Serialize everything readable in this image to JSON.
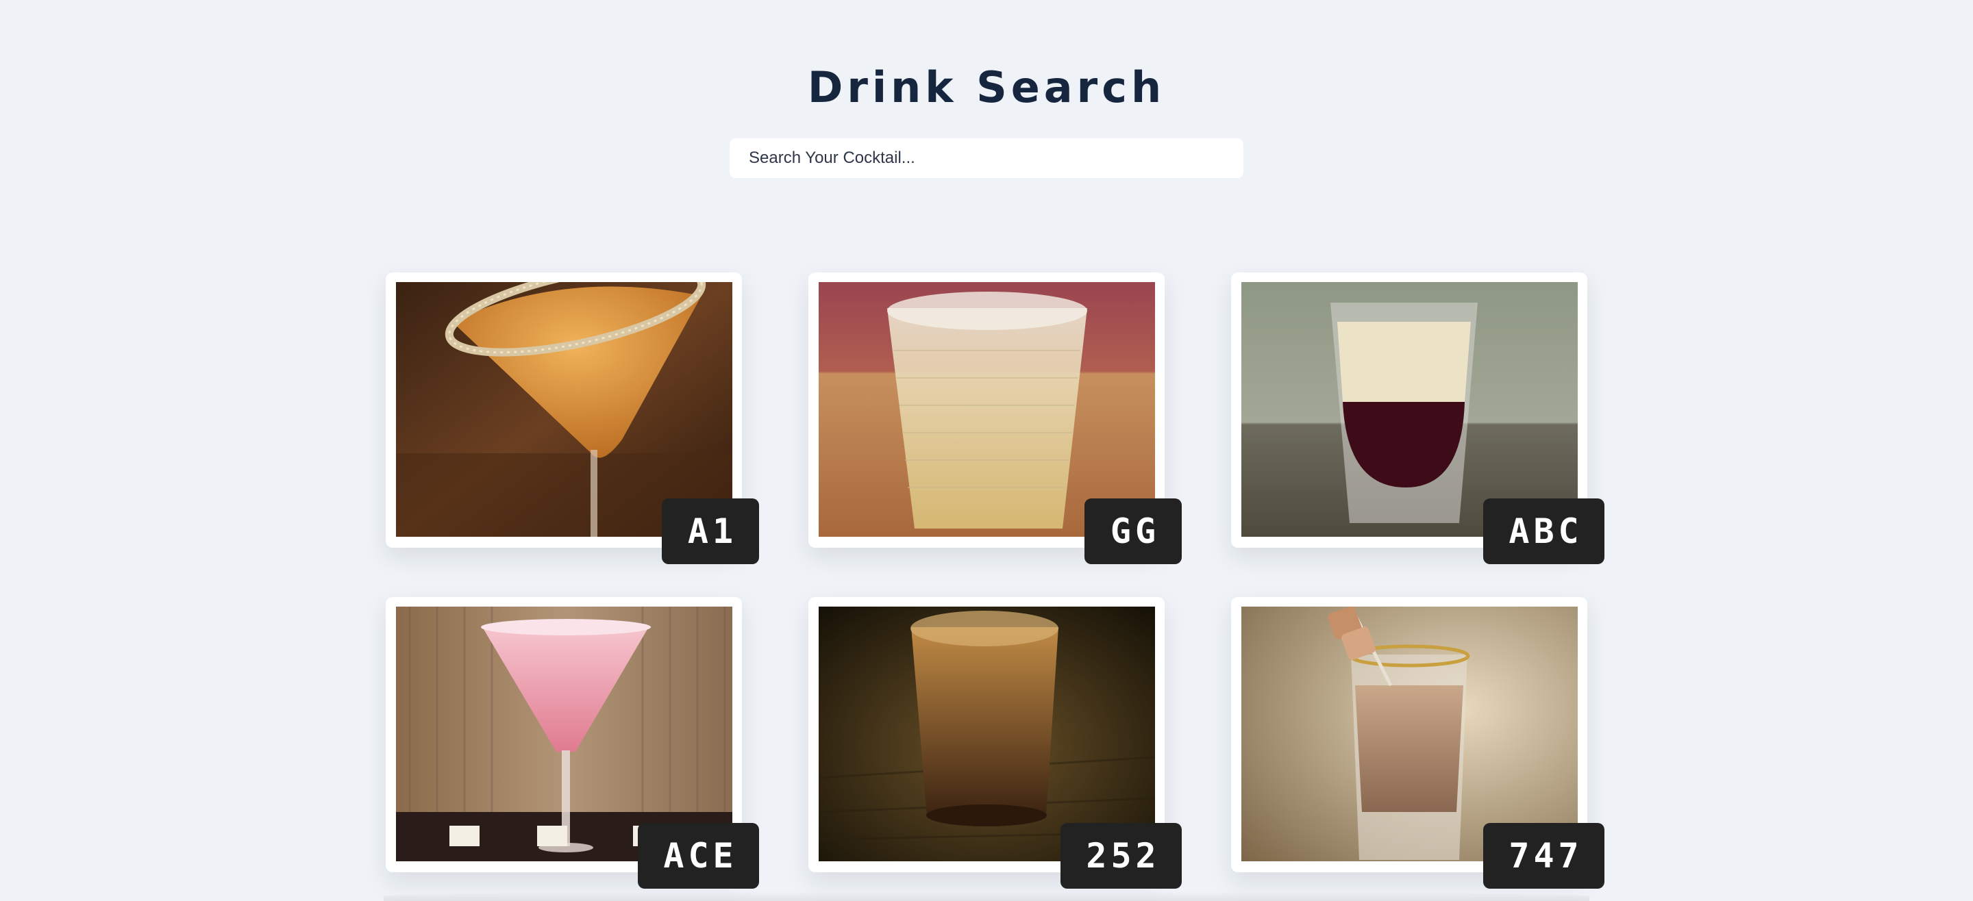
{
  "header": {
    "title": "Drink Search"
  },
  "search": {
    "placeholder": "Search Your Cocktail..."
  },
  "drinks": [
    {
      "code": "A1",
      "image": "amber-martini-with-sugar-rim"
    },
    {
      "code": "GG",
      "image": "rocks-glass-clear-drink"
    },
    {
      "code": "ABC",
      "image": "layered-cream-shot"
    },
    {
      "code": "ACE",
      "image": "pink-martini-with-candles"
    },
    {
      "code": "252",
      "image": "dark-whiskey-shot"
    },
    {
      "code": "747",
      "image": "cream-shot-with-caramel"
    }
  ],
  "colors": {
    "background": "#eff3f7",
    "title": "#17263f",
    "badge": "#222222",
    "badge_text": "#ffffff"
  }
}
